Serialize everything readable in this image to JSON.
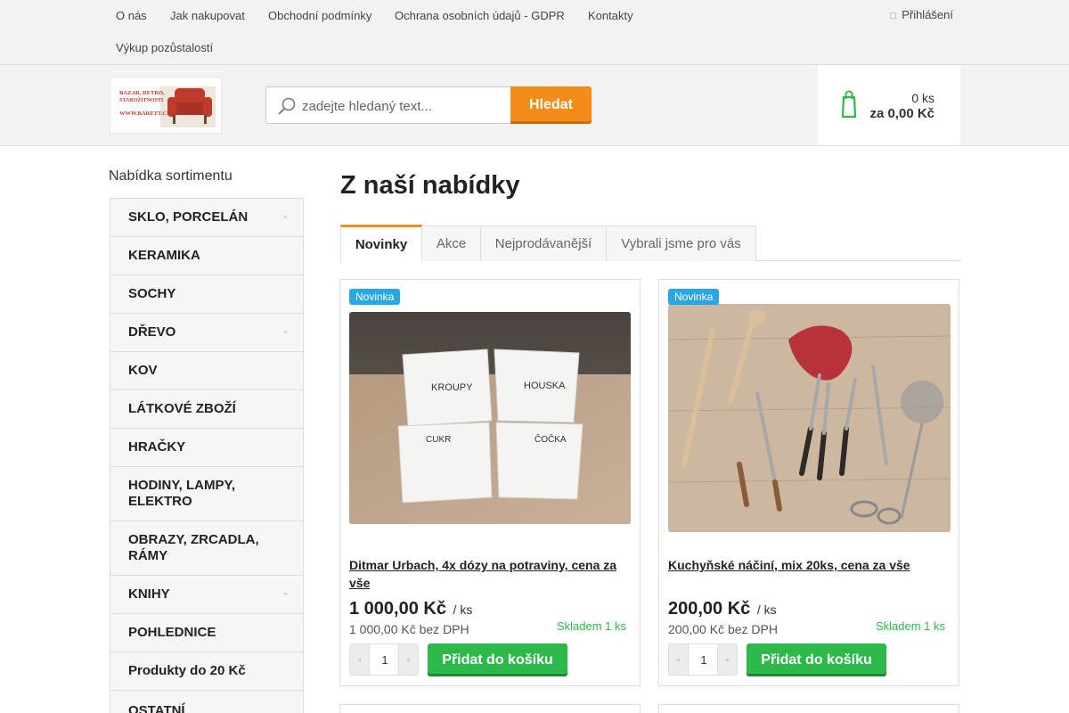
{
  "topnav": {
    "links": [
      "O nás",
      "Jak nakupovat",
      "Obchodní podmínky",
      "Ochrana osobních údajů - GDPR",
      "Kontakty",
      "Výkup pozůstalostí"
    ],
    "login_label": "Přihlášení"
  },
  "logo": {
    "text_line1": "BAZAR, RETRO,",
    "text_line2": "STAROŽITNOSTI",
    "text_line3": "WWW.BARETT.CZ"
  },
  "search": {
    "placeholder": "zadejte hledaný text...",
    "button_label": "Hledat"
  },
  "cart": {
    "quantity": "0 ks",
    "total": "za 0,00 Kč"
  },
  "sidebar": {
    "title": "Nabídka sortimentu",
    "items": [
      {
        "label": "SKLO, PORCELÁN",
        "has_sub": true
      },
      {
        "label": "KERAMIKA",
        "has_sub": false
      },
      {
        "label": "SOCHY",
        "has_sub": false
      },
      {
        "label": "DŘEVO",
        "has_sub": true
      },
      {
        "label": "KOV",
        "has_sub": false
      },
      {
        "label": "LÁTKOVÉ ZBOŽÍ",
        "has_sub": false
      },
      {
        "label": "HRAČKY",
        "has_sub": false
      },
      {
        "label": "HODINY, LAMPY, ELEKTRO",
        "has_sub": false
      },
      {
        "label": "OBRAZY, ZRCADLA, RÁMY",
        "has_sub": false
      },
      {
        "label": "KNIHY",
        "has_sub": true
      },
      {
        "label": "POHLEDNICE",
        "has_sub": false
      },
      {
        "label": "Produkty do 20 Kč",
        "has_sub": false
      },
      {
        "label": "OSTATNÍ",
        "has_sub": false
      }
    ]
  },
  "main": {
    "title": "Z naší nabídky",
    "tabs": [
      {
        "label": "Novinky",
        "active": true
      },
      {
        "label": "Akce",
        "active": false
      },
      {
        "label": "Nejprodávanější",
        "active": false
      },
      {
        "label": "Vybrali jsme pro vás",
        "active": false
      }
    ]
  },
  "products": [
    {
      "badge": "Novinka",
      "name": "Ditmar Urbach, 4x dózy na potraviny, cena za vše",
      "price": "1 000,00 Kč",
      "unit": "/ ks",
      "price_net": "1 000,00 Kč bez DPH",
      "stock": "Skladem 1 ks",
      "quantity": "1",
      "add_label": "Přidat do košíku",
      "jar_labels": [
        "KROUPY",
        "HOUSKA",
        "CUKR",
        "ČOČKA"
      ]
    },
    {
      "badge": "Novinka",
      "name": "Kuchyňské náčiní, mix 20ks, cena za vše",
      "price": "200,00 Kč",
      "unit": "/ ks",
      "price_net": "200,00 Kč bez DPH",
      "stock": "Skladem 1 ks",
      "quantity": "1",
      "add_label": "Přidat do košíku"
    }
  ],
  "icons": {
    "lock": "lock-icon",
    "search": "search-icon",
    "cart": "shopping-bag-icon",
    "submenu": "chevron-right-icon",
    "minus": "minus-icon",
    "plus": "plus-icon"
  },
  "colors": {
    "accent_orange": "#f28c1a",
    "accent_green": "#2db84b",
    "badge_blue": "#29a6e4"
  }
}
